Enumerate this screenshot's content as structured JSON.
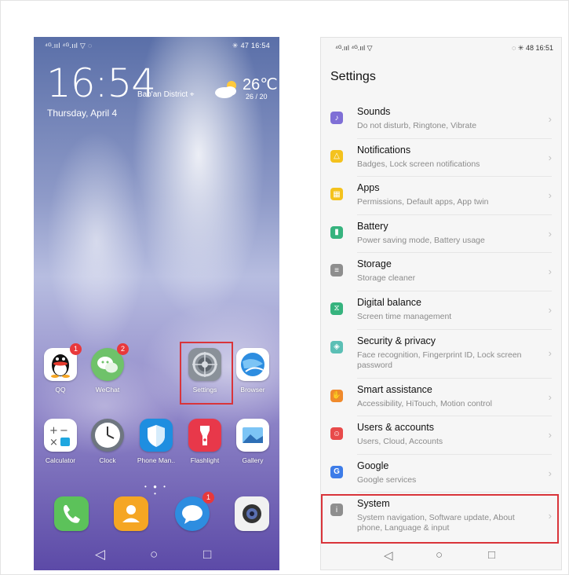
{
  "left_phone": {
    "status_left": "⁴ᴳ.ııl ⁴ᴳ.ııl ▽ ◌",
    "status_right": "✳ 47 16:54",
    "clock": "16:54",
    "district": "Bao'an District ⌖",
    "date": "Thursday, April 4",
    "temperature": "26℃",
    "temp_range": "26 / 20",
    "apps_row1": [
      {
        "label": "QQ",
        "badge": "1"
      },
      {
        "label": "WeChat",
        "badge": "2"
      },
      {
        "label": "Settings",
        "badge": ""
      },
      {
        "label": "Browser",
        "badge": ""
      }
    ],
    "apps_row2": [
      {
        "label": "Calculator"
      },
      {
        "label": "Clock"
      },
      {
        "label": "Phone Man.."
      },
      {
        "label": "Flashlight"
      },
      {
        "label": "Gallery"
      }
    ],
    "dock_badge": "1",
    "dots": "• ● • •",
    "nav": {
      "back": "◁",
      "home": "○",
      "recent": "□"
    }
  },
  "right_phone": {
    "status_left": "⁴ᴳ.ııl ⁴ᴳ.ııl ▽",
    "status_right": "◌ ✳ 48 16:51",
    "title": "Settings",
    "items": [
      {
        "title": "Sounds",
        "subtitle": "Do not disturb, Ringtone, Vibrate",
        "color": "#7f6fd6",
        "glyph": "♪"
      },
      {
        "title": "Notifications",
        "subtitle": "Badges, Lock screen notifications",
        "color": "#f4c21d",
        "glyph": "△"
      },
      {
        "title": "Apps",
        "subtitle": "Permissions, Default apps, App twin",
        "color": "#f4c21d",
        "glyph": "▦"
      },
      {
        "title": "Battery",
        "subtitle": "Power saving mode, Battery usage",
        "color": "#36b37e",
        "glyph": "▮"
      },
      {
        "title": "Storage",
        "subtitle": "Storage cleaner",
        "color": "#8e8e8e",
        "glyph": "≡"
      },
      {
        "title": "Digital balance",
        "subtitle": "Screen time management",
        "color": "#36b37e",
        "glyph": "⧖"
      },
      {
        "title": "Security & privacy",
        "subtitle": "Face recognition, Fingerprint ID, Lock screen password",
        "color": "#5bbfb5",
        "glyph": "◈"
      },
      {
        "title": "Smart assistance",
        "subtitle": "Accessibility, HiTouch, Motion control",
        "color": "#f08a2c",
        "glyph": "✋"
      },
      {
        "title": "Users & accounts",
        "subtitle": "Users, Cloud, Accounts",
        "color": "#e84a4a",
        "glyph": "☺"
      },
      {
        "title": "Google",
        "subtitle": "Google services",
        "color": "#3d7ce8",
        "glyph": "G"
      },
      {
        "title": "System",
        "subtitle": "System navigation, Software update, About phone, Language & input",
        "color": "#8e8e8e",
        "glyph": "i"
      }
    ],
    "chevron": "›",
    "nav": {
      "back": "◁",
      "home": "○",
      "recent": "□"
    }
  }
}
